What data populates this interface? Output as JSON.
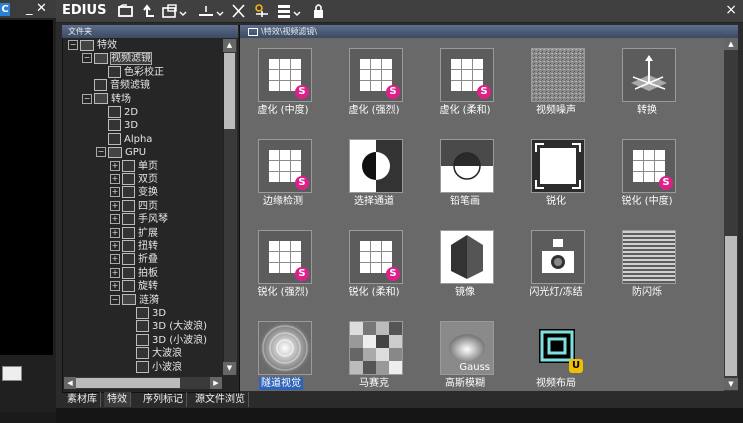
{
  "left_tag": "C",
  "app": {
    "title": "EDIUS",
    "close": "×"
  },
  "folder_panel": {
    "header": "文件夹",
    "tree": [
      {
        "label": "特效",
        "toggle": "−",
        "type": "folder",
        "level": 0
      },
      {
        "label": "视频滤镜",
        "toggle": "−",
        "type": "folder",
        "level": 1,
        "selected": true
      },
      {
        "label": "色彩校正",
        "toggle": "",
        "type": "item",
        "level": 2
      },
      {
        "label": "音频滤镜",
        "toggle": "",
        "type": "item",
        "level": 1
      },
      {
        "label": "转场",
        "toggle": "−",
        "type": "folder",
        "level": 1
      },
      {
        "label": "2D",
        "toggle": "",
        "type": "item",
        "level": 2
      },
      {
        "label": "3D",
        "toggle": "",
        "type": "item",
        "level": 2
      },
      {
        "label": "Alpha",
        "toggle": "",
        "type": "item",
        "level": 2
      },
      {
        "label": "GPU",
        "toggle": "−",
        "type": "folder",
        "level": 2
      },
      {
        "label": "单页",
        "toggle": "+",
        "type": "item",
        "level": 3
      },
      {
        "label": "双页",
        "toggle": "+",
        "type": "item",
        "level": 3
      },
      {
        "label": "变换",
        "toggle": "+",
        "type": "item",
        "level": 3
      },
      {
        "label": "四页",
        "toggle": "+",
        "type": "item",
        "level": 3
      },
      {
        "label": "手风琴",
        "toggle": "+",
        "type": "item",
        "level": 3
      },
      {
        "label": "扩展",
        "toggle": "+",
        "type": "item",
        "level": 3
      },
      {
        "label": "扭转",
        "toggle": "+",
        "type": "item",
        "level": 3
      },
      {
        "label": "折叠",
        "toggle": "+",
        "type": "item",
        "level": 3
      },
      {
        "label": "拍板",
        "toggle": "+",
        "type": "item",
        "level": 3
      },
      {
        "label": "旋转",
        "toggle": "+",
        "type": "item",
        "level": 3
      },
      {
        "label": "涟漪",
        "toggle": "−",
        "type": "folder",
        "level": 3
      },
      {
        "label": "3D",
        "toggle": "",
        "type": "item",
        "level": 4
      },
      {
        "label": "3D (大波浪)",
        "toggle": "",
        "type": "item",
        "level": 4
      },
      {
        "label": "3D (小波浪)",
        "toggle": "",
        "type": "item",
        "level": 4
      },
      {
        "label": "大波浪",
        "toggle": "",
        "type": "item",
        "level": 4
      },
      {
        "label": "小波浪",
        "toggle": "",
        "type": "item",
        "level": 4
      }
    ]
  },
  "tabs": [
    "素材库",
    "特效",
    "序列标记",
    "源文件浏览"
  ],
  "active_tab": 1,
  "effect_panel": {
    "path": "\\特效\\视频滤镜\\",
    "effects": [
      {
        "label": "虚化 (中度)",
        "icon": "grid-icon",
        "badge": "S"
      },
      {
        "label": "虚化 (强烈)",
        "icon": "grid-icon",
        "badge": "S"
      },
      {
        "label": "虚化 (柔和)",
        "icon": "grid-icon",
        "badge": "S"
      },
      {
        "label": "视频噪声",
        "icon": "noise-icon",
        "badge": ""
      },
      {
        "label": "转换",
        "icon": "axis-3d-icon",
        "badge": ""
      },
      {
        "label": "边缘检测",
        "icon": "grid-icon",
        "badge": "S"
      },
      {
        "label": "选择通道",
        "icon": "channel-select-icon",
        "badge": ""
      },
      {
        "label": "铅笔画",
        "icon": "pencil-sketch-icon",
        "badge": ""
      },
      {
        "label": "锐化",
        "icon": "sharpen-icon",
        "badge": ""
      },
      {
        "label": "锐化 (中度)",
        "icon": "grid-icon",
        "badge": "S"
      },
      {
        "label": "锐化 (强烈)",
        "icon": "grid-icon",
        "badge": "S"
      },
      {
        "label": "锐化 (柔和)",
        "icon": "grid-icon",
        "badge": "S"
      },
      {
        "label": "镜像",
        "icon": "mirror-icon",
        "badge": ""
      },
      {
        "label": "闪光灯/冻结",
        "icon": "camera-flash-icon",
        "badge": ""
      },
      {
        "label": "防闪烁",
        "icon": "flicker-lines-icon",
        "badge": ""
      },
      {
        "label": "隧道视觉",
        "icon": "tunnel-icon",
        "badge": "",
        "selected": true
      },
      {
        "label": "马赛克",
        "icon": "mosaic-icon",
        "badge": ""
      },
      {
        "label": "高斯模糊",
        "icon": "gauss-icon",
        "badge": "",
        "overlay": "Gauss"
      },
      {
        "label": "视频布局",
        "icon": "layout-icon",
        "badge": "U"
      }
    ]
  },
  "colors": {
    "badge_s": "#e0208a",
    "badge_u": "#f0c000",
    "selection": "#2e63b8",
    "panel_bg": "#696969"
  }
}
